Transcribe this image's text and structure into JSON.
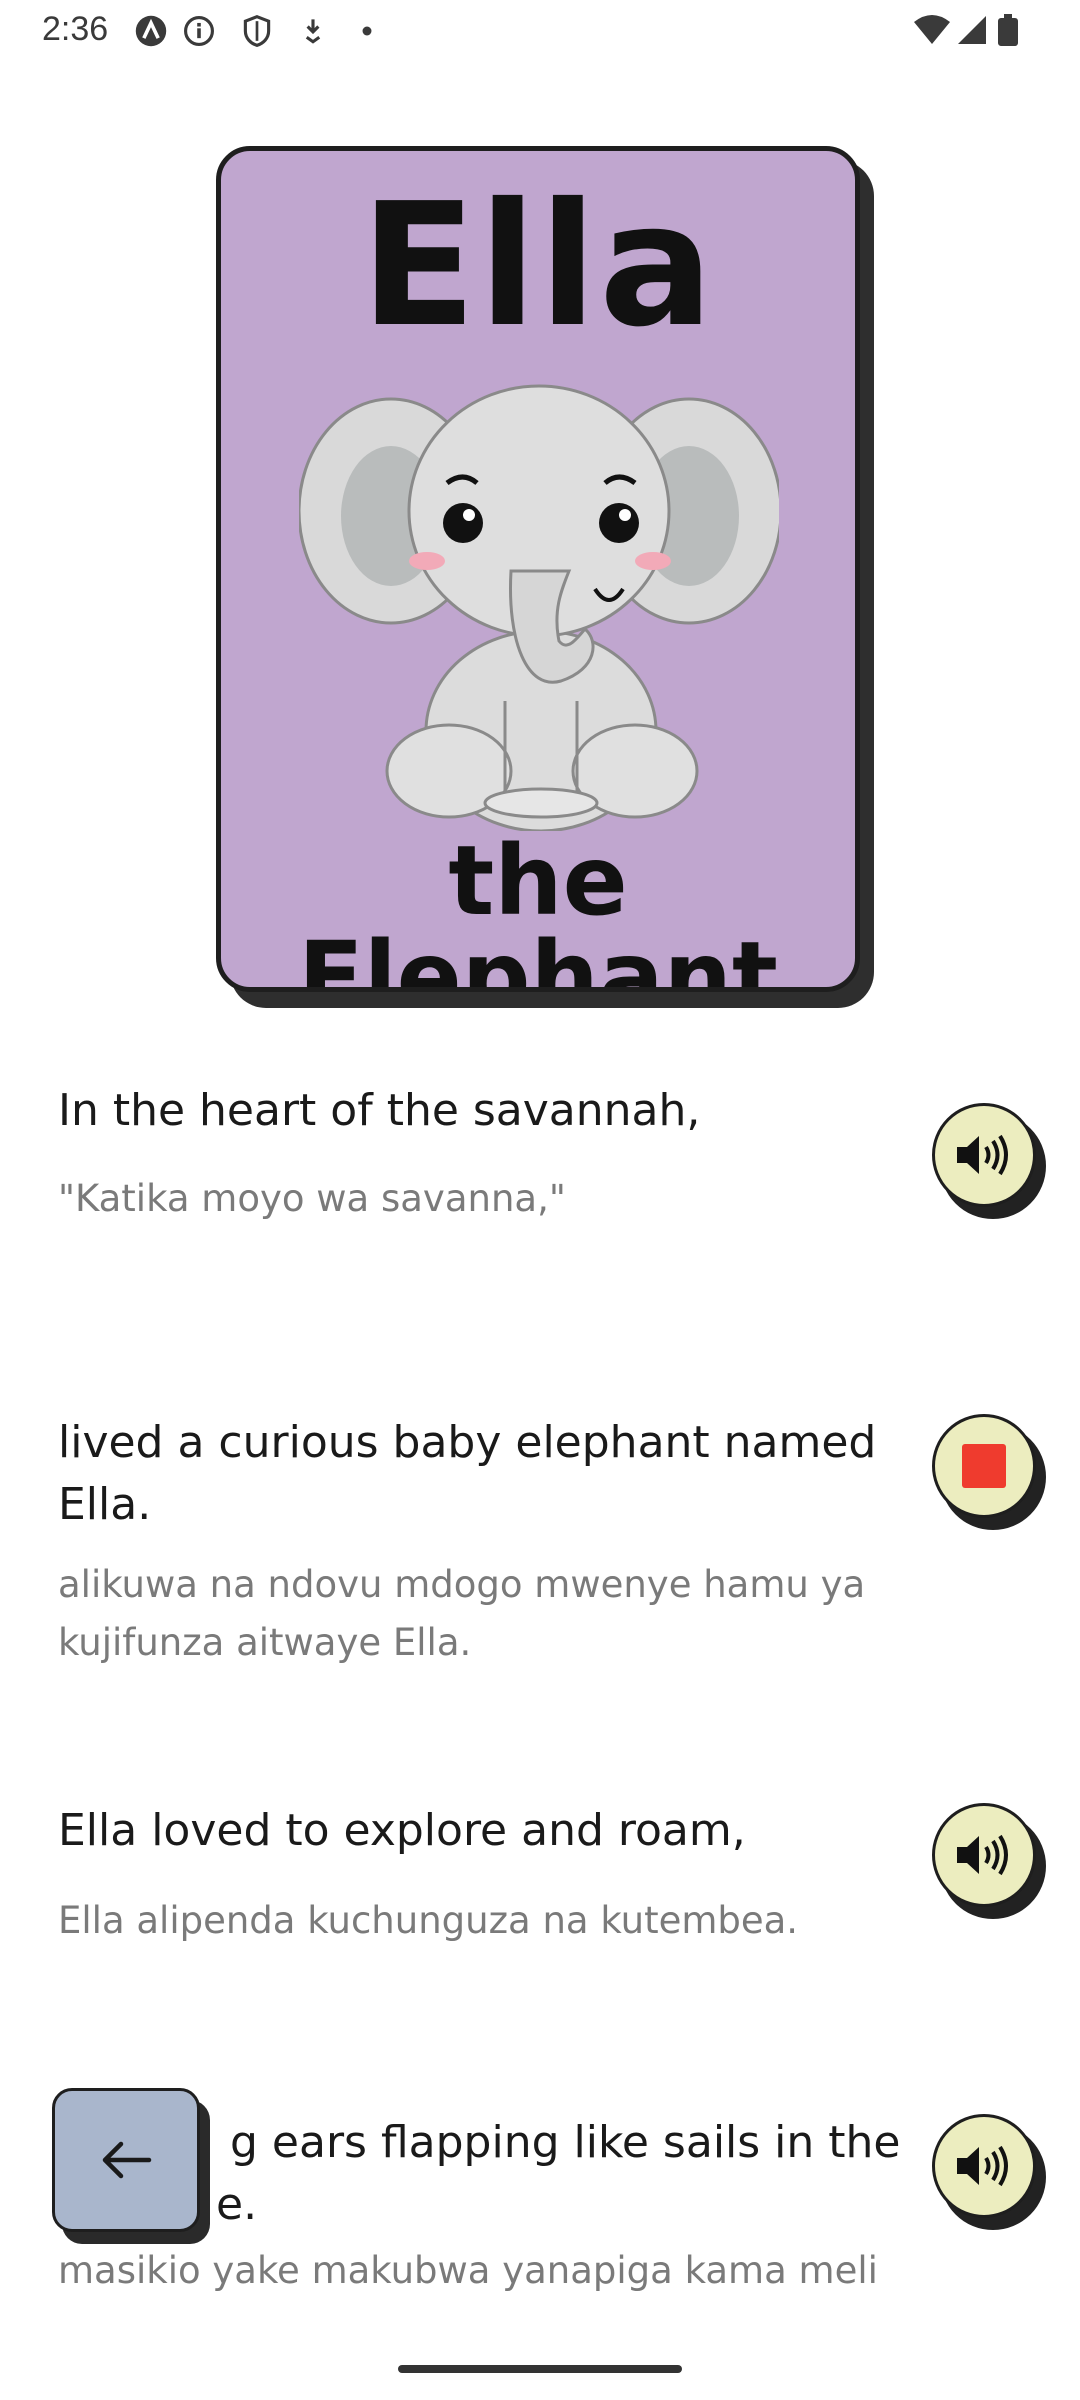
{
  "status_bar": {
    "time": "2:36",
    "icons": [
      "app-a-icon",
      "info-icon",
      "shield-icon",
      "download-icon",
      "dot-icon"
    ],
    "right_icons": [
      "wifi-icon",
      "signal-icon",
      "battery-icon"
    ]
  },
  "cover": {
    "title": "Ella",
    "subtitle": "the Elephant",
    "background_color": "#c0a6cf"
  },
  "lines": [
    {
      "english": "In the heart of the savannah,",
      "swahili": "\"Katika moyo wa savanna,\"",
      "button_icon": "speaker-icon",
      "state": "idle"
    },
    {
      "english": "lived a curious baby elephant named Ella.",
      "swahili": "alikuwa na ndovu mdogo mwenye hamu ya kujifunza aitwaye Ella.",
      "button_icon": "stop-icon",
      "state": "playing"
    },
    {
      "english": "Ella loved to explore and roam,",
      "swahili": "Ella alipenda kuchunguza na kutembea.",
      "button_icon": "speaker-icon",
      "state": "idle"
    },
    {
      "english": "g ears flapping like sails in the",
      "english_line2": "e.",
      "swahili": "masikio yake makubwa yanapiga kama meli",
      "button_icon": "speaker-icon",
      "state": "idle"
    }
  ],
  "back_button": {
    "icon": "arrow-left-icon"
  },
  "colors": {
    "audio_button": "#ecedbf",
    "stop_square": "#ef3b2e",
    "back_button": "#a9b6cc"
  }
}
